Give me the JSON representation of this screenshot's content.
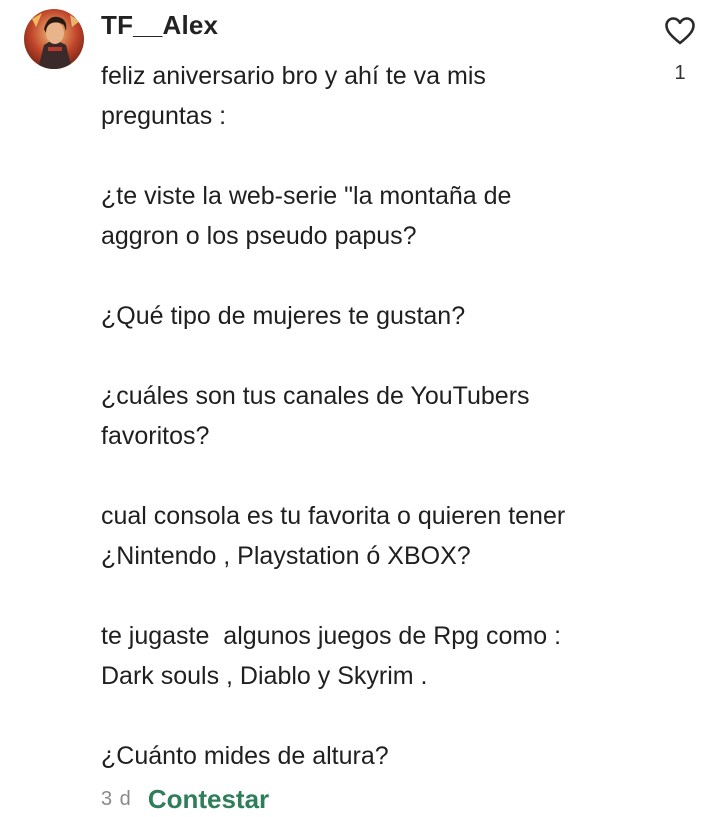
{
  "comment": {
    "username": "TF__Alex",
    "avatar_icon": "avatar-image",
    "like_icon": "heart-outline-icon",
    "like_count": "1",
    "lines": [
      "feliz aniversario bro y ahí te va mis",
      "preguntas :",
      "",
      "¿te viste la web-serie \"la montaña de",
      "aggron o los pseudo papus?",
      "",
      "¿Qué tipo de mujeres te gustan?",
      "",
      "¿cuáles son tus canales de YouTubers",
      "favoritos?",
      "",
      "cual consola es tu favorita o quieren tener",
      "¿Nintendo , Playstation ó XBOX?",
      "",
      "te jugaste  algunos juegos de Rpg como :",
      "Dark souls , Diablo y Skyrim .",
      "",
      "¿Cuánto mides de altura?"
    ],
    "timestamp": "3 d",
    "reply_label": "Contestar",
    "colors": {
      "reply": "#2e7d5b",
      "timestamp": "#8a8a8a",
      "text": "#1f1f1f"
    }
  }
}
